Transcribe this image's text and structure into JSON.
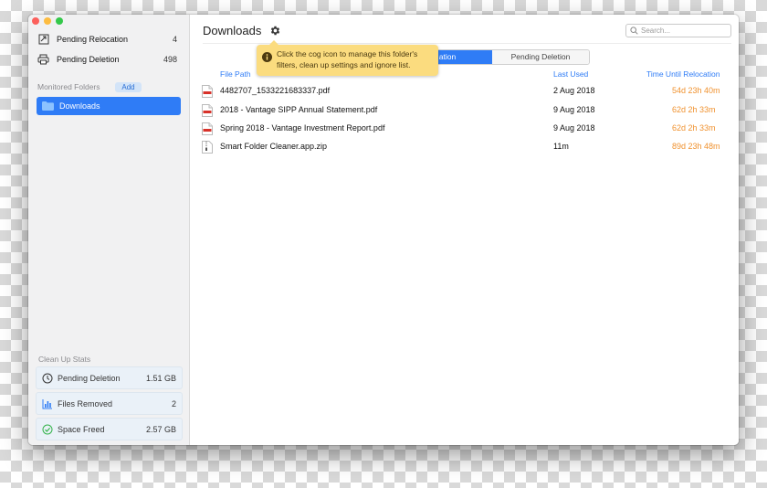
{
  "colors": {
    "accent": "#2f7cf6",
    "countdown": "#f0922f",
    "tooltip_bg": "#fbdc7f",
    "close": "#fc605c",
    "minimize": "#fdbc40",
    "maximize": "#34c84a"
  },
  "sidebar": {
    "items": [
      {
        "label": "Pending Relocation",
        "count": "4",
        "icon": "relocation-icon"
      },
      {
        "label": "Pending Deletion",
        "count": "498",
        "icon": "printer-icon"
      }
    ],
    "monitored_title": "Monitored Folders",
    "add_label": "Add",
    "folders": [
      {
        "label": "Downloads",
        "icon": "folder-icon",
        "selected": true
      }
    ],
    "stats_title": "Clean Up Stats",
    "stats": [
      {
        "label": "Pending Deletion",
        "value": "1.51 GB",
        "icon": "clock-icon"
      },
      {
        "label": "Files Removed",
        "value": "2",
        "icon": "bar-chart-icon"
      },
      {
        "label": "Space Freed",
        "value": "2.57 GB",
        "icon": "checkmark-icon"
      }
    ]
  },
  "main": {
    "title": "Downloads",
    "search": {
      "placeholder": "Search..."
    },
    "segments": [
      "ation",
      "Pending Deletion"
    ],
    "tooltip": "Click the cog icon to manage this folder's filters, clean up settings and ignore list.",
    "columns": {
      "path": "File Path",
      "used": "Last Used",
      "until": "Time Until Relocation"
    },
    "rows": [
      {
        "path": "4482707_1533221683337.pdf",
        "used": "2 Aug 2018",
        "until": "54d 23h 40m",
        "icon": "pdf-icon"
      },
      {
        "path": "2018 - Vantage SIPP Annual Statement.pdf",
        "used": "9 Aug 2018",
        "until": "62d 2h 33m",
        "icon": "pdf-icon"
      },
      {
        "path": "Spring 2018 - Vantage Investment Report.pdf",
        "used": "9 Aug 2018",
        "until": "62d 2h 33m",
        "icon": "pdf-icon"
      },
      {
        "path": "Smart Folder Cleaner.app.zip",
        "used": "11m",
        "until": "89d 23h 48m",
        "icon": "zip-icon"
      }
    ]
  }
}
